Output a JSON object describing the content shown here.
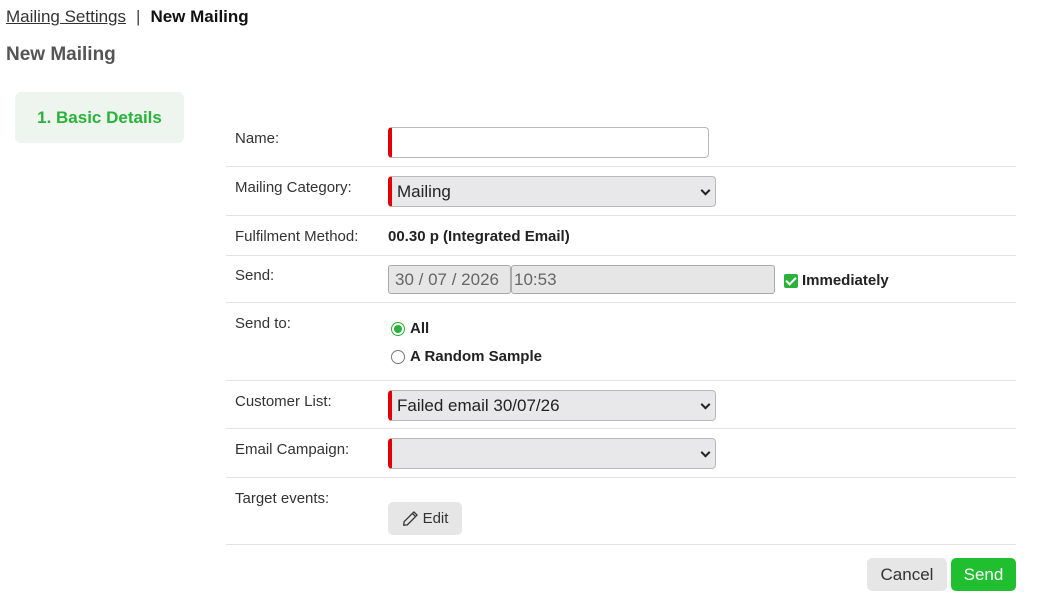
{
  "breadcrumb": {
    "parent": "Mailing Settings",
    "separator": "|",
    "current": "New Mailing"
  },
  "page_title": "New Mailing",
  "steps": [
    {
      "label": "1. Basic Details",
      "active": true
    }
  ],
  "form": {
    "name": {
      "label": "Name:",
      "value": ""
    },
    "mailing_category": {
      "label": "Mailing Category:",
      "value": "Mailing"
    },
    "fulfilment_method": {
      "label": "Fulfilment Method:",
      "value": "00.30 p (Integrated Email)"
    },
    "send": {
      "label": "Send:",
      "date": "30 / 07 / 2026",
      "time": "10:53",
      "immediately_label": "Immediately",
      "immediately_checked": true
    },
    "send_to": {
      "label": "Send to:",
      "options": [
        {
          "label": "All",
          "selected": true
        },
        {
          "label": "A Random Sample",
          "selected": false
        }
      ]
    },
    "customer_list": {
      "label": "Customer List:",
      "value": "Failed email 30/07/26"
    },
    "email_campaign": {
      "label": "Email Campaign:",
      "value": ""
    },
    "target_events": {
      "label": "Target events:",
      "edit_label": "Edit"
    }
  },
  "actions": {
    "cancel": "Cancel",
    "send": "Send"
  },
  "colors": {
    "accent": "#2ab23a",
    "required": "#e00000",
    "send_button": "#1fbf30"
  }
}
